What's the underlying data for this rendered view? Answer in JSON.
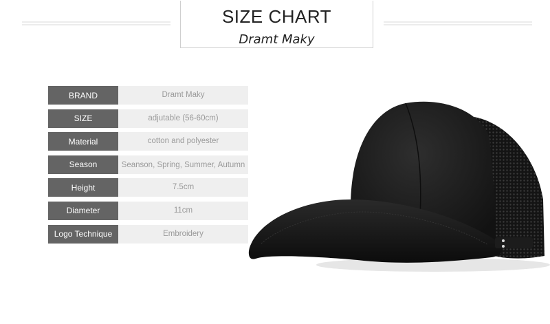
{
  "header": {
    "title": "SIZE CHART",
    "brand_subtitle": "Dramt Maky"
  },
  "specs": [
    {
      "label": "BRAND",
      "value": "Dramt Maky"
    },
    {
      "label": "SIZE",
      "value": "adjutable (56-60cm)"
    },
    {
      "label": "Material",
      "value": "cotton and polyester"
    },
    {
      "label": "Season",
      "value": "Seanson, Spring, Summer, Autumn"
    },
    {
      "label": "Height",
      "value": "7.5cm"
    },
    {
      "label": "Diameter",
      "value": "11cm"
    },
    {
      "label": "Logo Technique",
      "value": "Embroidery"
    }
  ],
  "colors": {
    "label_bg": "#646464",
    "value_bg": "#efefef",
    "cap": "#1a1a1a"
  }
}
